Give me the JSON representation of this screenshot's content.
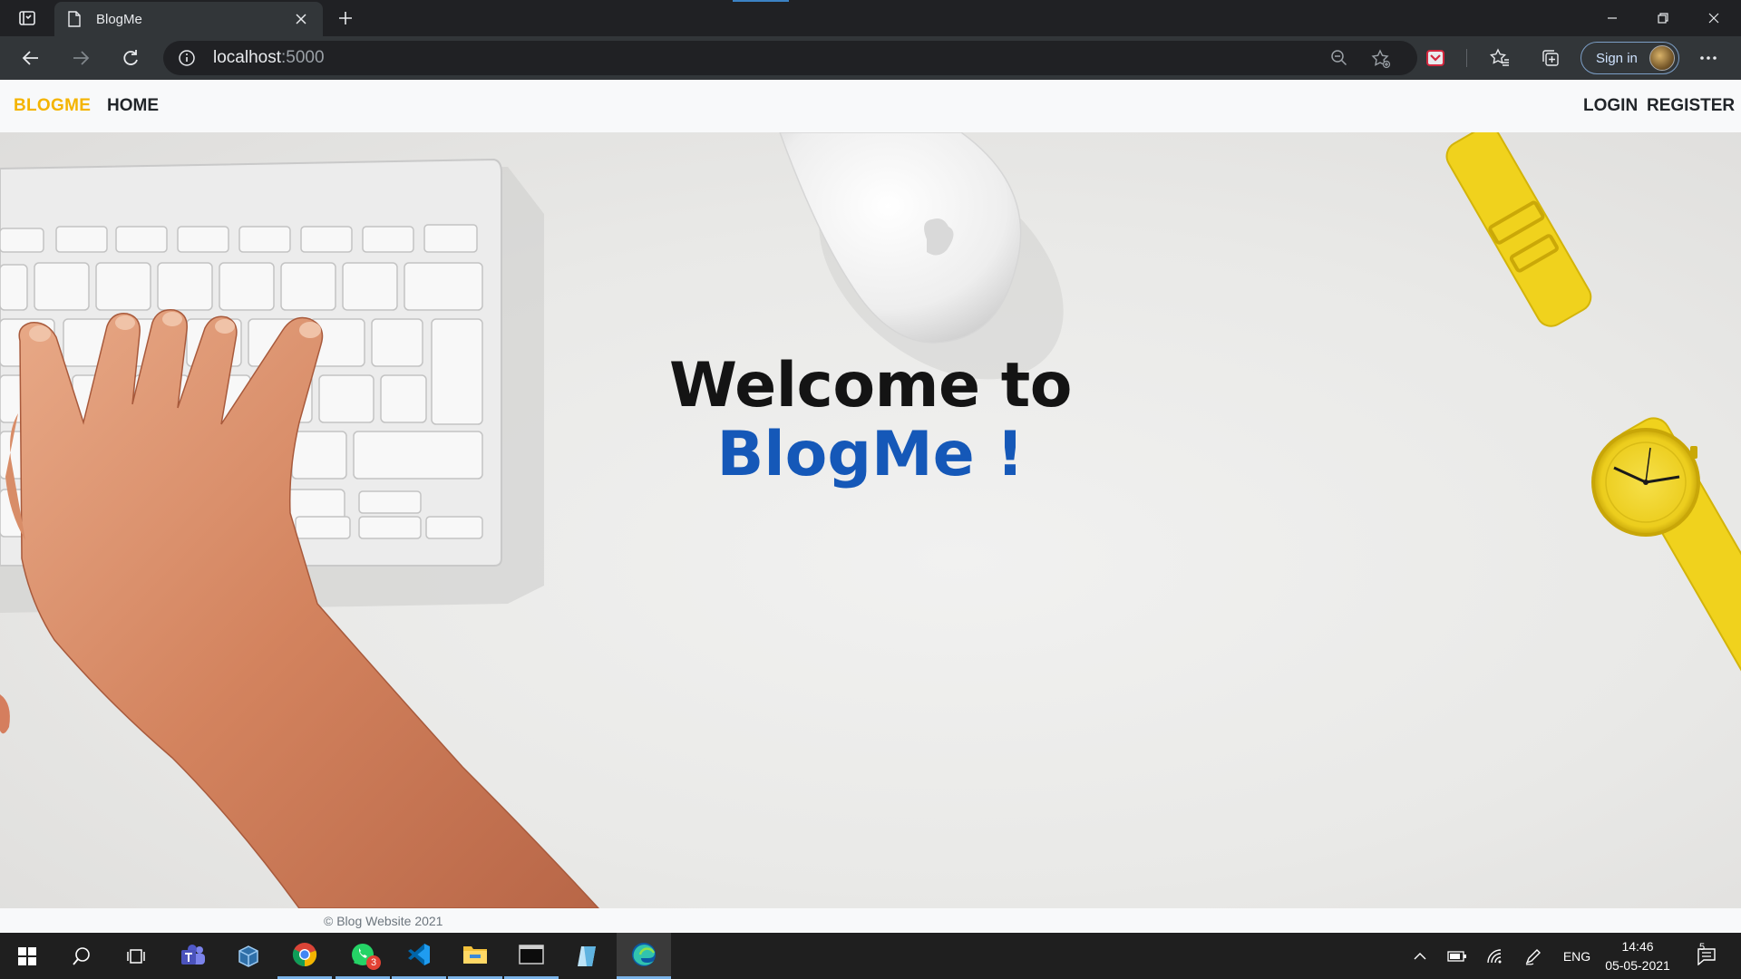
{
  "browser": {
    "tab_title": "BlogMe",
    "url_host": "localhost",
    "url_port": ":5000",
    "signin_label": "Sign in",
    "accent": "#7c9ec6"
  },
  "site": {
    "brand": "BLOGME",
    "brand_color": "#f4b400",
    "nav_left": [
      "HOME"
    ],
    "nav_right": [
      "LOGIN",
      "REGISTER"
    ],
    "hero_line1": "Welcome to",
    "hero_line2": "BlogMe !",
    "hero_accent": "#1558b8",
    "footer": "© Blog Website 2021"
  },
  "taskbar": {
    "apps": [
      "start",
      "search",
      "task-view",
      "teams",
      "virtualbox",
      "chrome",
      "whatsapp",
      "vscode",
      "file-explorer",
      "terminal",
      "notes",
      "edge"
    ],
    "whatsapp_badge": "3",
    "language": "ENG",
    "time": "14:46",
    "date": "05-05-2021",
    "notification_count": "5"
  }
}
